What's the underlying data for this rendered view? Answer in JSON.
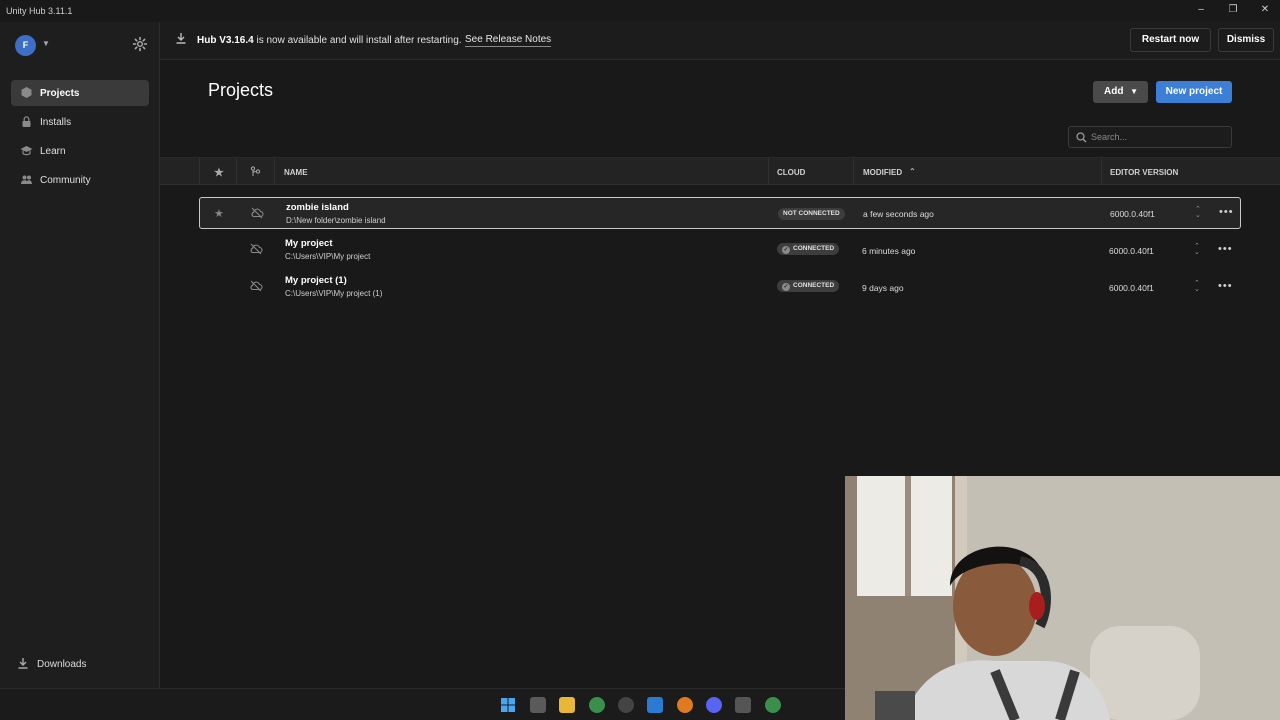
{
  "window": {
    "title": "Unity Hub 3.11.1"
  },
  "sidebar": {
    "avatar_initial": "F",
    "items": [
      {
        "label": "Projects",
        "icon": "cube-icon",
        "active": true
      },
      {
        "label": "Installs",
        "icon": "lock-icon",
        "active": false
      },
      {
        "label": "Learn",
        "icon": "graduation-cap-icon",
        "active": false
      },
      {
        "label": "Community",
        "icon": "people-icon",
        "active": false
      }
    ],
    "downloads_label": "Downloads"
  },
  "banner": {
    "version": "Hub V3.16.4",
    "message": " is now available and will install after restarting.",
    "release_notes_label": "See Release Notes",
    "restart_label": "Restart now",
    "dismiss_label": "Dismiss"
  },
  "main": {
    "title": "Projects",
    "add_label": "Add",
    "new_project_label": "New project",
    "search_placeholder": "Search..."
  },
  "table": {
    "columns": {
      "name": "NAME",
      "cloud": "CLOUD",
      "modified": "MODIFIED",
      "editor_version": "EDITOR VERSION"
    },
    "rows": [
      {
        "name": "zombie island",
        "path": "D:\\New folder\\zombie island",
        "cloud": "NOT CONNECTED",
        "modified": "a few seconds ago",
        "version": "6000.0.40f1",
        "selected": true
      },
      {
        "name": "My project",
        "path": "C:\\Users\\VIP\\My project",
        "cloud": "CONNECTED",
        "modified": "6 minutes ago",
        "version": "6000.0.40f1",
        "selected": false
      },
      {
        "name": "My project (1)",
        "path": "C:\\Users\\VIP\\My project (1)",
        "cloud": "CONNECTED",
        "modified": "9 days ago",
        "version": "6000.0.40f1",
        "selected": false
      }
    ]
  },
  "colors": {
    "accent": "#3d7ed6",
    "background": "#191919",
    "sidebar": "#1e1e1e"
  }
}
